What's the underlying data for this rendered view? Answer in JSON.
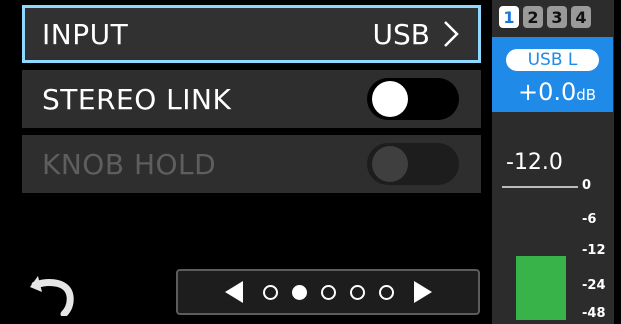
{
  "menu": {
    "input": {
      "label": "INPUT",
      "value": "USB"
    },
    "stereo_link": {
      "label": "STEREO LINK",
      "state": "on"
    },
    "knob_hold": {
      "label": "KNOB HOLD",
      "state": "disabled"
    }
  },
  "pager": {
    "page_count": 5,
    "current_page": 2
  },
  "meter": {
    "channels": [
      "1",
      "2",
      "3",
      "4"
    ],
    "active_channel": "1",
    "source": "USB L",
    "gain": "+0.0",
    "gain_unit": "dB",
    "level": "-12.0",
    "scale": [
      "0",
      "-6",
      "-12",
      "-24",
      "-48"
    ]
  },
  "colors": {
    "accent": "#1f8ae8",
    "highlight": "#8fd8ff",
    "meter_green": "#38b34a"
  }
}
